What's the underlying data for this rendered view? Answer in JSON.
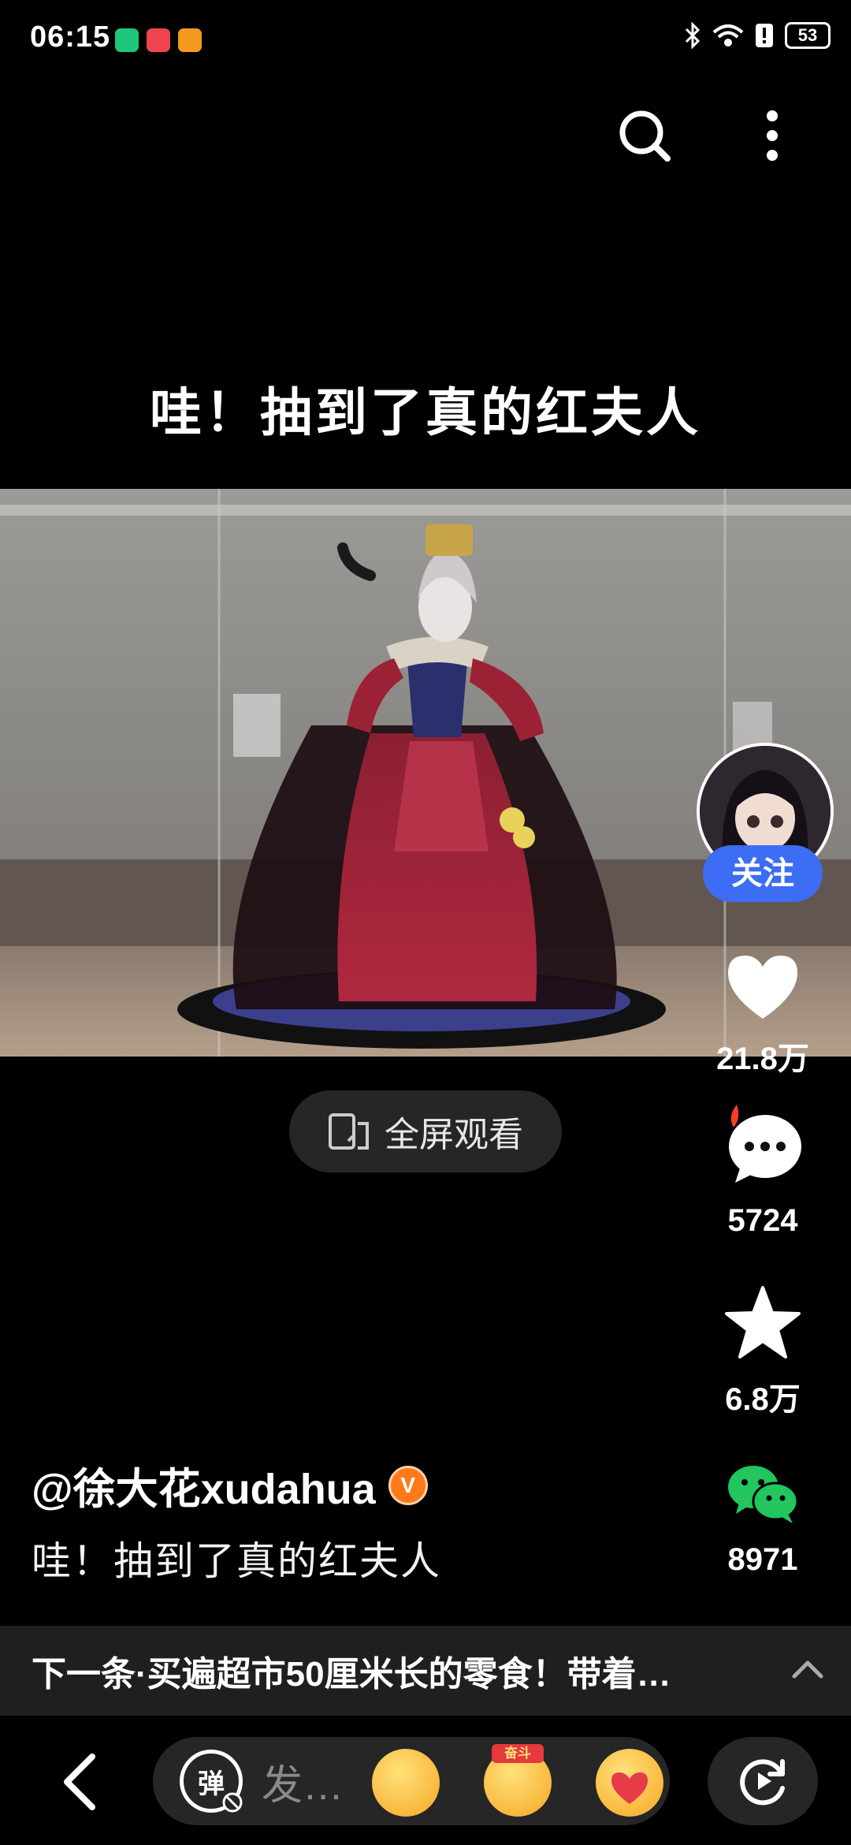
{
  "status_bar": {
    "time": "06:15",
    "battery": "53",
    "icons": [
      "hourglass-app-icon",
      "red-app-icon",
      "orange-app-icon",
      "bluetooth-icon",
      "wifi-icon",
      "alert-icon",
      "battery-icon"
    ]
  },
  "header": {
    "actions": [
      "search-icon",
      "more-icon"
    ]
  },
  "video": {
    "title": "哇！抽到了真的红夫人",
    "fullscreen_label": "全屏观看"
  },
  "rail": {
    "follow_label": "关注",
    "likes": "21.8万",
    "comments": "5724",
    "favorites": "6.8万",
    "shares": "8971"
  },
  "author": {
    "name": "@徐大花xudahua",
    "verified_mark": "V"
  },
  "caption": "哇！抽到了真的红夫人",
  "next_up": {
    "text": "下一条·买遍超市50厘米长的零食！带着…"
  },
  "bottom_bar": {
    "danmu_label": "弹",
    "input_placeholder": "发…",
    "emoji_badge": "奋斗"
  },
  "colors": {
    "accent_blue": "#3d6cf5",
    "wechat_green": "#22c55e",
    "verified_orange": "#ff7a1a",
    "hot_red": "#ff3b2f"
  }
}
